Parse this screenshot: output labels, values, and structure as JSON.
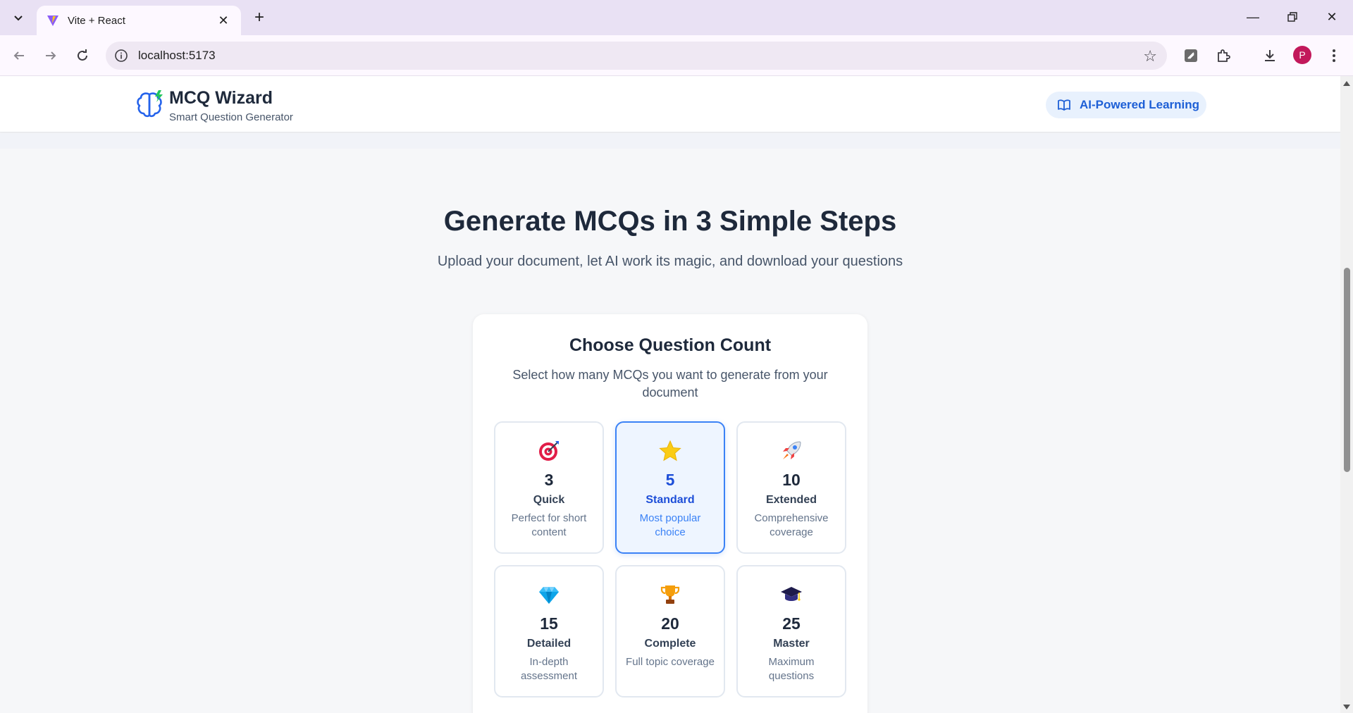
{
  "browser": {
    "tab_title": "Vite + React",
    "url": "localhost:5173",
    "profile_initial": "P"
  },
  "header": {
    "brand_title": "MCQ Wizard",
    "brand_subtitle": "Smart Question Generator",
    "pill_label": "AI-Powered Learning"
  },
  "hero": {
    "title": "Generate MCQs in 3 Simple Steps",
    "subtitle": "Upload your document, let AI work its magic, and download your questions"
  },
  "question_count": {
    "title": "Choose Question Count",
    "description": "Select how many MCQs you want to generate from your document",
    "selected_index": 1,
    "options": [
      {
        "count": "3",
        "label": "Quick",
        "description": "Perfect for short content",
        "icon": "target-icon"
      },
      {
        "count": "5",
        "label": "Standard",
        "description": "Most popular choice",
        "icon": "star-icon"
      },
      {
        "count": "10",
        "label": "Extended",
        "description": "Comprehensive coverage",
        "icon": "rocket-icon"
      },
      {
        "count": "15",
        "label": "Detailed",
        "description": "In-depth assessment",
        "icon": "gem-icon"
      },
      {
        "count": "20",
        "label": "Complete",
        "description": "Full topic coverage",
        "icon": "trophy-icon"
      },
      {
        "count": "25",
        "label": "Master",
        "description": "Maximum questions",
        "icon": "graduation-cap-icon"
      }
    ]
  },
  "colors": {
    "accent": "#3b82f6",
    "accent_text": "#1d4ed8",
    "pill_bg": "#e8f1fd",
    "avatar": "#c2185b"
  }
}
